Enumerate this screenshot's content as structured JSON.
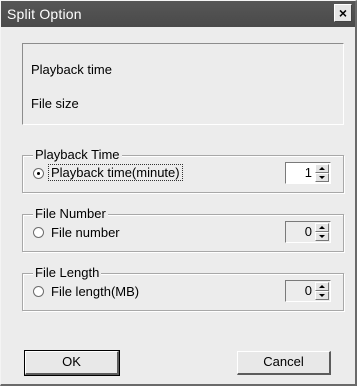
{
  "window": {
    "title": "Split Option",
    "close_label": "×"
  },
  "info": {
    "line1": "Playback time",
    "line2": "File size"
  },
  "groups": [
    {
      "title": "Playback Time",
      "option_label": "Playback time(minute)",
      "checked": true,
      "value": "1"
    },
    {
      "title": "File Number",
      "option_label": "File number",
      "checked": false,
      "value": "0"
    },
    {
      "title": "File Length",
      "option_label": "File length(MB)",
      "checked": false,
      "value": "0"
    }
  ],
  "buttons": {
    "ok": "OK",
    "cancel": "Cancel"
  }
}
